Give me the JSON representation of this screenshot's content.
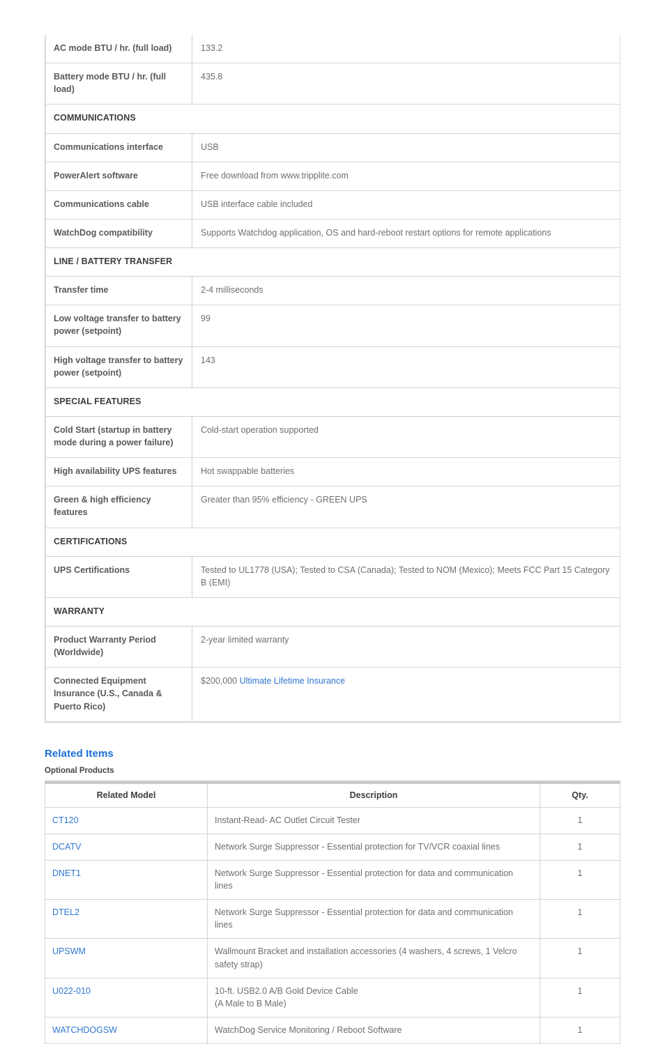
{
  "spec_table": {
    "columns": [
      "label",
      "value"
    ],
    "rows": [
      {
        "type": "row",
        "label": "AC mode BTU / hr. (full load)",
        "value": "133.2"
      },
      {
        "type": "row",
        "label": "Battery mode BTU / hr. (full load)",
        "value": "435.8"
      },
      {
        "type": "section",
        "label": "COMMUNICATIONS"
      },
      {
        "type": "row",
        "label": "Communications interface",
        "value": "USB"
      },
      {
        "type": "row",
        "label": "PowerAlert software",
        "value": "Free download from www.tripplite.com"
      },
      {
        "type": "row",
        "label": "Communications cable",
        "value": "USB interface cable included"
      },
      {
        "type": "row",
        "label": "WatchDog compatibility",
        "value": "Supports Watchdog application, OS and hard-reboot restart options for remote applications"
      },
      {
        "type": "section",
        "label": "LINE / BATTERY TRANSFER"
      },
      {
        "type": "row",
        "label": "Transfer time",
        "value": "2-4 milliseconds"
      },
      {
        "type": "row",
        "label": "Low voltage transfer to battery power (setpoint)",
        "value": "99"
      },
      {
        "type": "row",
        "label": "High voltage transfer to battery power (setpoint)",
        "value": "143"
      },
      {
        "type": "section",
        "label": "SPECIAL FEATURES"
      },
      {
        "type": "row",
        "label": "Cold Start (startup in battery mode during a power failure)",
        "value": "Cold-start operation supported"
      },
      {
        "type": "row",
        "label": "High availability UPS features",
        "value": "Hot swappable batteries"
      },
      {
        "type": "row",
        "label": "Green & high efficiency features",
        "value": "Greater than 95% efficiency - GREEN UPS"
      },
      {
        "type": "section",
        "label": "CERTIFICATIONS"
      },
      {
        "type": "row",
        "label": "UPS Certifications",
        "value": "Tested to UL1778 (USA); Tested to CSA (Canada); Tested to NOM (Mexico); Meets FCC Part 15 Category B (EMI)"
      },
      {
        "type": "section",
        "label": "WARRANTY"
      },
      {
        "type": "row",
        "label": "Product Warranty Period (Worldwide)",
        "value": "2-year limited warranty"
      },
      {
        "type": "row_link",
        "label": "Connected Equipment Insurance (U.S., Canada & Puerto Rico)",
        "value_prefix": "$200,000 ",
        "value_link": "Ultimate Lifetime Insurance"
      }
    ]
  },
  "related": {
    "heading": "Related Items",
    "subheading": "Optional Products",
    "headers": {
      "model": "Related Model",
      "description": "Description",
      "qty": "Qty."
    },
    "rows": [
      {
        "model": "CT120",
        "description": "Instant-Read- AC Outlet Circuit Tester",
        "qty": "1"
      },
      {
        "model": "DCATV",
        "description": "Network Surge Suppressor - Essential protection for TV/VCR coaxial lines",
        "qty": "1"
      },
      {
        "model": "DNET1",
        "description": "Network Surge Suppressor - Essential protection for data and communication lines",
        "qty": "1"
      },
      {
        "model": "DTEL2",
        "description": "Network Surge Suppressor - Essential protection for data and communication lines",
        "qty": "1"
      },
      {
        "model": "UPSWM",
        "description": "Wallmount Bracket and installation accessories (4 washers, 4 screws, 1 Velcro safety strap)",
        "qty": "1"
      },
      {
        "model": "U022-010",
        "description_line1": "10-ft. USB2.0 A/B Gold Device Cable",
        "description_line2": "(A Male to B Male)",
        "qty": "1"
      },
      {
        "model": "WATCHDOGSW",
        "description": "WatchDog Service Monitoring / Reboot Software",
        "qty": "1"
      }
    ]
  },
  "colors": {
    "link": "#2e77d0",
    "heading": "#1a6fd4",
    "label_text": "#58595b",
    "value_text": "#6d6e71",
    "border": "#d3d3d3"
  }
}
